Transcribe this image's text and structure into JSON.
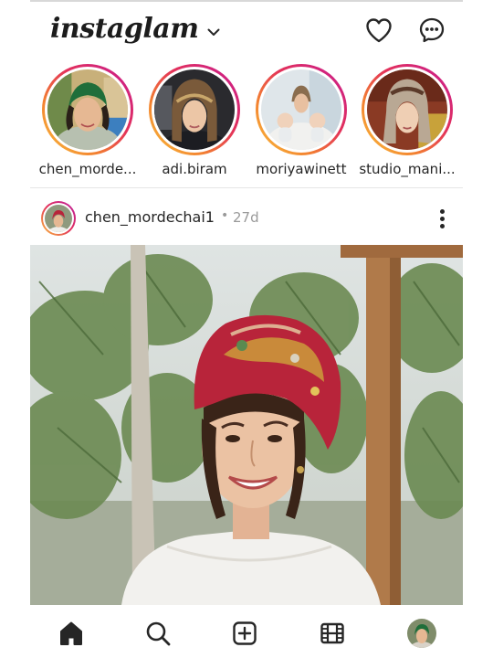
{
  "header": {
    "brand": "instaglam",
    "icons": {
      "brand_menu": "chevron-down-icon",
      "activity": "heart-icon",
      "messages": "messenger-icon"
    }
  },
  "stories": [
    {
      "username": "chen_morde...",
      "avatar": "green-headscarf-portrait"
    },
    {
      "username": "adi.biram",
      "avatar": "car-selfie-portrait"
    },
    {
      "username": "moriyawinett",
      "avatar": "mother-with-twins-portrait"
    },
    {
      "username": "studio_mani...",
      "avatar": "floral-scarf-portrait"
    }
  ],
  "post": {
    "username": "chen_mordechai1",
    "separator": "•",
    "time": "27d",
    "image": "woman-in-red-turban-outdoors",
    "more_icon": "more-vertical-icon"
  },
  "bottom_nav": {
    "items": [
      "home-icon",
      "search-icon",
      "new-post-icon",
      "reels-icon",
      "profile-avatar"
    ],
    "active": "home-icon"
  },
  "colors": {
    "story_ring_start": "#f9c33c",
    "story_ring_mid": "#e3315a",
    "story_ring_end": "#bb1fa0",
    "text": "#262626",
    "muted": "#9a9a9a"
  }
}
